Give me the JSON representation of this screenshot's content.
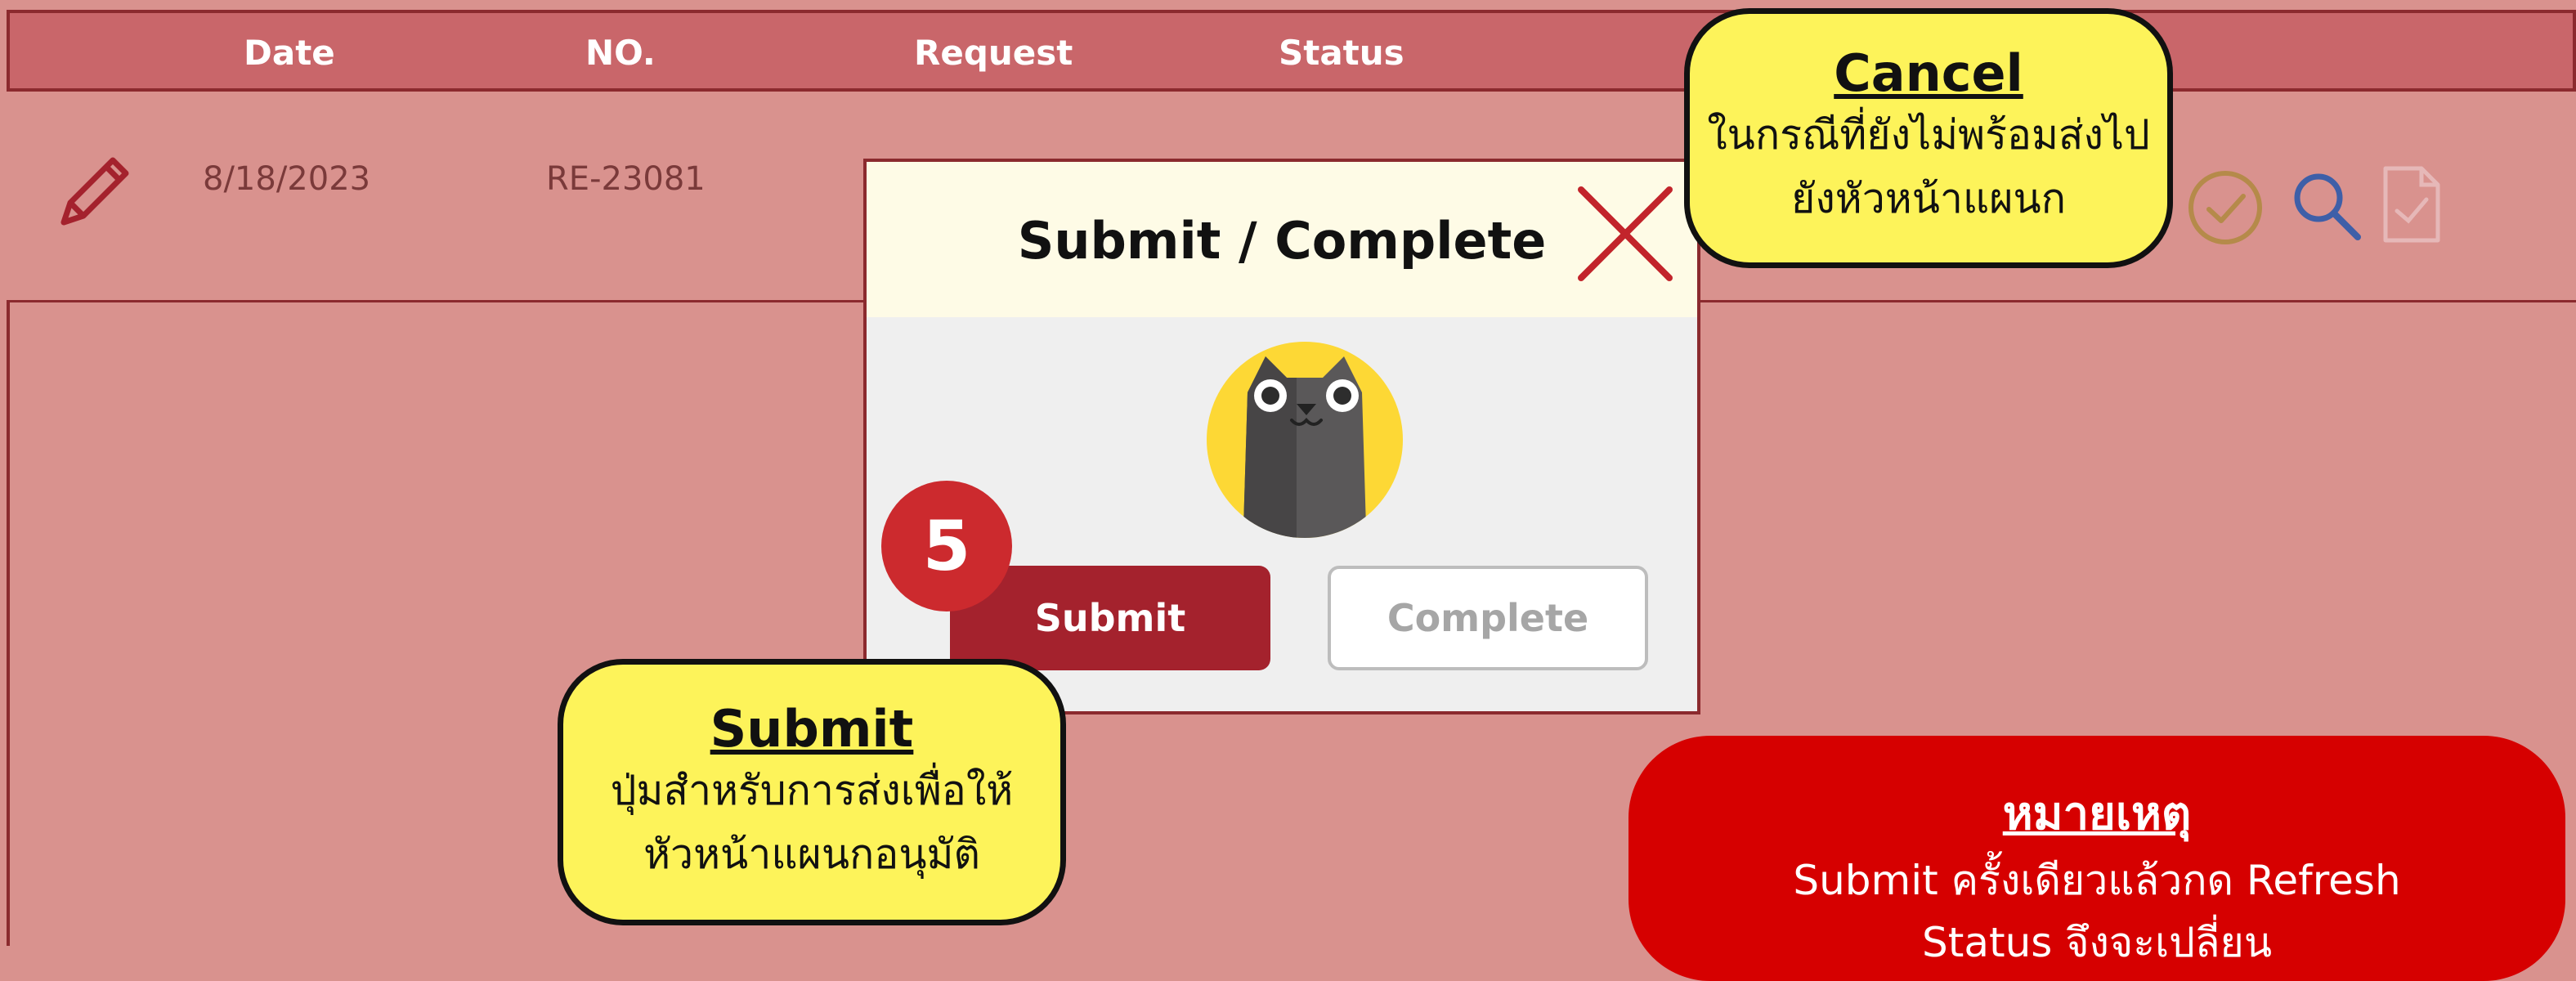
{
  "table": {
    "headers": [
      "Date",
      "NO.",
      "Request",
      "Status"
    ],
    "rows": [
      {
        "date": "8/18/2023",
        "no": "RE-23081"
      }
    ],
    "row_icons": [
      "pencil-icon",
      "check-circle-icon",
      "search-icon",
      "document-check-icon"
    ]
  },
  "dialog": {
    "title": "Submit / Complete",
    "submit_label": "Submit",
    "complete_label": "Complete",
    "close_icon": "close-icon",
    "avatar_icon": "cat-avatar-icon"
  },
  "step_badge": "5",
  "callouts": {
    "cancel": {
      "title": "Cancel",
      "line1": "ในกรณีที่ยังไม่พร้อมส่งไป",
      "line2": "ยังหัวหน้าแผนก"
    },
    "submit": {
      "title": "Submit",
      "line1": "ปุ่มสำหรับการส่งเพื่อให้",
      "line2": "หัวหน้าแผนกอนุมัติ"
    }
  },
  "note": {
    "title": "หมายเหตุ",
    "line1": "Submit ครั้งเดียวแล้วกด Refresh",
    "line2": "Status จึงจะเปลี่ยน"
  },
  "colors": {
    "header_bg": "#c9666a",
    "row_bg": "#d9928e",
    "submit_button": "#a4222d",
    "callout_bg": "#fdf35a",
    "note_bg": "#d60000",
    "badge_bg": "#cc2a2e"
  }
}
